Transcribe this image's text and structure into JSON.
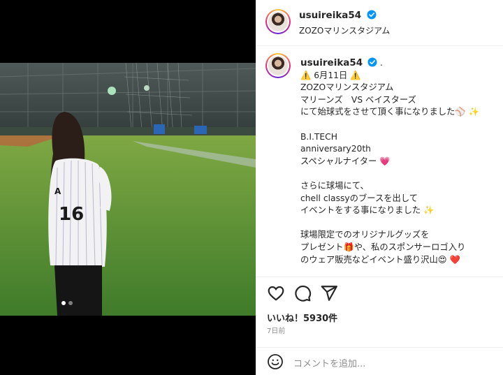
{
  "post": {
    "username": "usuireika54",
    "location": "ZOZOマリンスタジアム",
    "caption_suffix": ".",
    "caption_lines": [
      "⚠️ 6月11日 ⚠️",
      "ZOZOマリンスタジアム",
      "マリーンズ　VS ベイスターズ",
      "にて始球式をさせて頂く事になりました⚾ ✨",
      "",
      "B.I.TECH",
      "anniversary20th",
      "スペシャルナイター 💗",
      "",
      "さらに球場にて、",
      "chell classyのブースを出して",
      "イベントをする事になりました ✨",
      "",
      "球場限定でのオリジナルグッズを",
      "プレゼント🎁や、私のスポンサーロゴ入り",
      "のウェア販売などイベント盛り沢山😍 ❤️"
    ],
    "likes": "いいね！5930件",
    "date": "7日前",
    "comment_placeholder": "コメントを追加..."
  },
  "photo": {
    "jersey_text": "16",
    "jersey_letter": "A"
  },
  "icons": {
    "like": "heart-icon",
    "comment": "comment-icon",
    "share": "share-icon",
    "emoji": "emoji-icon",
    "verified": "verified-badge-icon"
  },
  "colors": {
    "verified": "#0095f6",
    "text": "#262626",
    "muted": "#8e8e8e",
    "border": "#efefef"
  },
  "carousel": {
    "count": 2,
    "active": 1
  }
}
